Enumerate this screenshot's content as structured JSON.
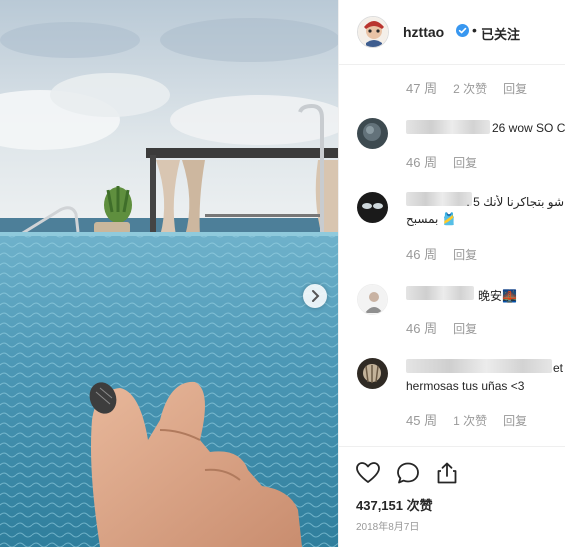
{
  "post": {
    "username": "hzttao",
    "follow_status": "已关注",
    "separator": "•"
  },
  "comments": [
    {
      "text": "",
      "time": "47 周",
      "likes": "2 次赞",
      "reply": "回复"
    },
    {
      "text": "26 wow SO C",
      "time": "46 周",
      "reply": "回复"
    },
    {
      "text": "شو بتجاكرنا لأنك 5 .",
      "text2": "بمسبح 🎽",
      "time": "46 周",
      "reply": "回复"
    },
    {
      "text": "晚安🌉",
      "time": "46 周",
      "reply": "回复"
    },
    {
      "text": "et",
      "text2": "hermosas tus uñas <3",
      "time": "45 周",
      "likes": "1 次赞",
      "reply": "回复"
    }
  ],
  "engagement": {
    "like_count": "437,151 次赞",
    "date": "2018年8月7日"
  },
  "icons": {
    "like": "heart-icon",
    "comment": "comment-icon",
    "share": "share-icon",
    "next": "chevron-right-icon",
    "verified": "verified-badge-icon"
  },
  "colors": {
    "verified": "#3897f0",
    "muted": "#999999",
    "text": "#262626"
  }
}
